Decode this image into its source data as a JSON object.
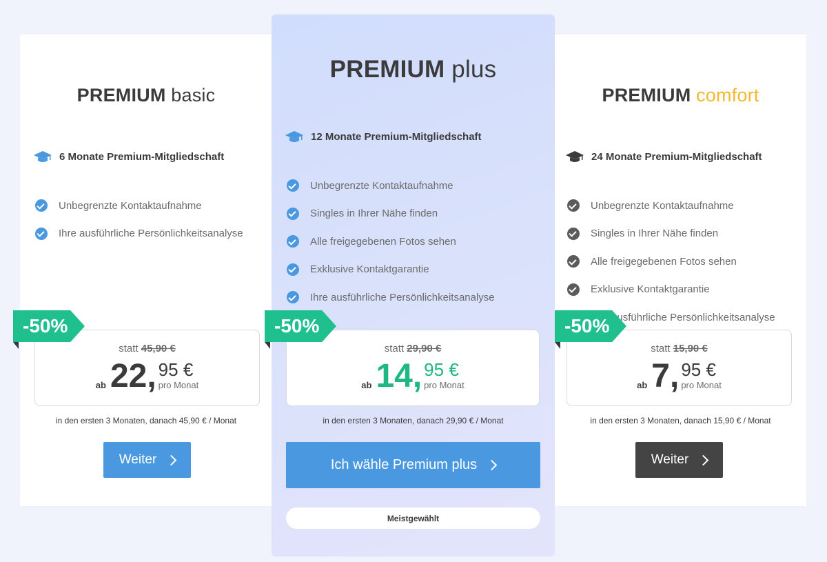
{
  "colors": {
    "accent_blue": "#4a99e0",
    "discount_green": "#1fc08e",
    "price_green": "#1fb784",
    "comfort_gold": "#f4b82a",
    "dark_button": "#444444"
  },
  "plans": {
    "basic": {
      "title_bold": "PREMIUM",
      "title_light": "basic",
      "membership": "6 Monate Premium-Mitgliedschaft",
      "membership_icon": "graduation-cap-icon",
      "features": [
        "Unbegrenzte Kontaktaufnahme",
        "Ihre ausführliche Persönlichkeitsanalyse"
      ],
      "discount": "-50%",
      "statt_label": "statt",
      "old_price": "45,90 €",
      "ab": "ab",
      "price_euros": "22",
      "price_comma": ",",
      "price_cents": "95 €",
      "per_month": "pro Monat",
      "note": "in den ersten 3 Monaten, danach 45,90 € / Monat",
      "button": "Weiter"
    },
    "plus": {
      "title_bold": "PREMIUM",
      "title_light": "plus",
      "membership": "12 Monate Premium-Mitgliedschaft",
      "membership_icon": "graduation-cap-icon",
      "features": [
        "Unbegrenzte Kontaktaufnahme",
        "Singles in Ihrer Nähe finden",
        "Alle freigegebenen Fotos sehen",
        "Exklusive Kontaktgarantie",
        "Ihre ausführliche Persönlichkeitsanalyse"
      ],
      "discount": "-50%",
      "statt_label": "statt",
      "old_price": "29,90 €",
      "ab": "ab",
      "price_euros": "14",
      "price_comma": ",",
      "price_cents": "95 €",
      "per_month": "pro Monat",
      "note": "in den ersten 3 Monaten, danach 29,90 € / Monat",
      "button": "Ich wähle Premium plus",
      "badge": "Meistgewählt"
    },
    "comfort": {
      "title_bold": "PREMIUM",
      "title_light": "comfort",
      "membership": "24 Monate Premium-Mitgliedschaft",
      "membership_icon": "graduation-cap-icon",
      "features": [
        "Unbegrenzte Kontaktaufnahme",
        "Singles in Ihrer Nähe finden",
        "Alle freigegebenen Fotos sehen",
        "Exklusive Kontaktgarantie",
        "Ihre ausführliche Persönlichkeitsanalyse"
      ],
      "discount": "-50%",
      "statt_label": "statt",
      "old_price": "15,90 €",
      "ab": "ab",
      "price_euros": "7",
      "price_comma": ",",
      "price_cents": "95 €",
      "per_month": "pro Monat",
      "note": "in den ersten 3 Monaten, danach 15,90 € / Monat",
      "button": "Weiter"
    }
  }
}
